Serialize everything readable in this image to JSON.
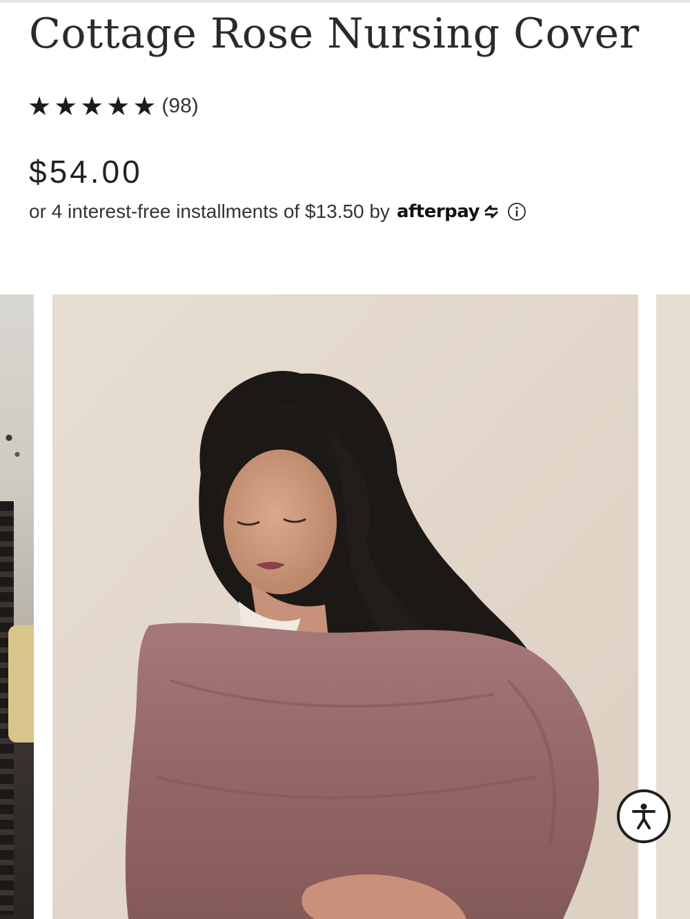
{
  "product": {
    "title": "Cottage Rose Nursing Cover",
    "rating": 5,
    "stars": [
      "★",
      "★",
      "★",
      "★",
      "★"
    ],
    "review_count": "(98)",
    "price": "$54.00",
    "installments_text": "or 4 interest-free installments of $13.50 by",
    "afterpay_label": "afterpay"
  },
  "icons": {
    "star": "star-icon",
    "afterpay_arrows": "afterpay-arrows-icon",
    "info": "info-icon",
    "accessibility": "accessibility-icon"
  },
  "gallery": {
    "images": [
      {
        "name": "previous-product-image",
        "visible": "partial"
      },
      {
        "name": "nursing-cover-model-photo",
        "visible": "full"
      },
      {
        "name": "next-product-image",
        "visible": "partial"
      }
    ]
  },
  "colors": {
    "text": "#2a2a2a",
    "cover_mauve": "#9c6e6b",
    "photo_background": "#e4d9cd"
  }
}
